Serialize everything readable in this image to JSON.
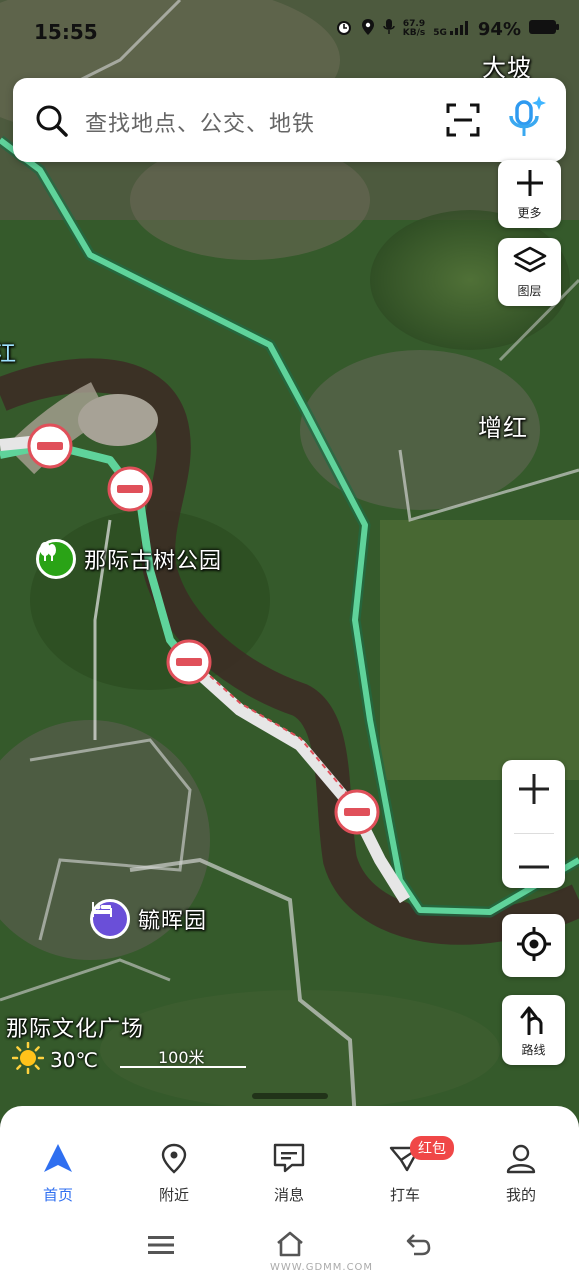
{
  "status_bar": {
    "time": "15:55",
    "network_speed_value": "67.9",
    "network_speed_unit": "KB/s",
    "network_type": "5G",
    "battery": "94%"
  },
  "search": {
    "placeholder": "查找地点、公交、地铁"
  },
  "map_controls": {
    "more_label": "更多",
    "layers_label": "图层",
    "route_label": "路线"
  },
  "map_labels": {
    "dapo": "大坡",
    "zenghong": "增红",
    "river_fragment": "江",
    "culture_square": "那际文化广场"
  },
  "pois": {
    "park": "那际古树公园",
    "hotel": "毓晖园"
  },
  "weather": {
    "temperature": "30℃"
  },
  "scale": {
    "label": "100米"
  },
  "bottom_nav": {
    "tabs": [
      {
        "label": "首页",
        "icon": "navigation-arrow-icon",
        "active": true
      },
      {
        "label": "附近",
        "icon": "location-pin-icon",
        "active": false
      },
      {
        "label": "消息",
        "icon": "message-icon",
        "active": false
      },
      {
        "label": "打车",
        "icon": "taxi-icon",
        "active": false
      },
      {
        "label": "我的",
        "icon": "user-icon",
        "active": false
      }
    ],
    "badge": "红包"
  },
  "watermark": "WWW.GDMM.COM",
  "colors": {
    "accent": "#2f6ff0",
    "road_green": "#5fd39b",
    "closure_red": "#e0505a",
    "badge_red": "#f04747",
    "park_green": "#2aa316",
    "hotel_purple": "#6a4fd8"
  }
}
